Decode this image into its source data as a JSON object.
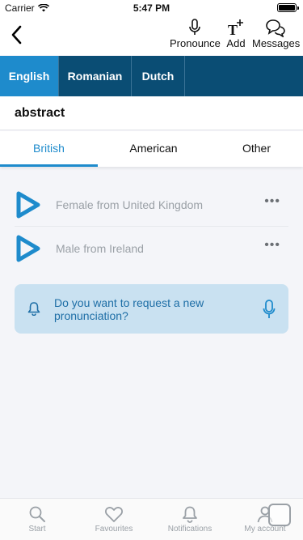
{
  "status_bar": {
    "carrier": "Carrier",
    "time": "5:47 PM"
  },
  "toolbar": {
    "pronounce_label": "Pronounce",
    "add_label": "Add",
    "messages_label": "Messages"
  },
  "languages": [
    {
      "label": "English",
      "active": true
    },
    {
      "label": "Romanian",
      "active": false
    },
    {
      "label": "Dutch",
      "active": false
    }
  ],
  "word": "abstract",
  "accents": [
    {
      "label": "British",
      "active": true
    },
    {
      "label": "American",
      "active": false
    },
    {
      "label": "Other",
      "active": false
    }
  ],
  "pronunciations": [
    {
      "label": "Female from United Kingdom",
      "more": "•••"
    },
    {
      "label": "Male from Ireland",
      "more": "•••"
    }
  ],
  "request": {
    "text": "Do you want to request a new pronunciation?"
  },
  "bottom_nav": [
    {
      "label": "Start",
      "icon": "search-icon"
    },
    {
      "label": "Favourites",
      "icon": "heart-icon"
    },
    {
      "label": "Notifications",
      "icon": "bell-icon"
    },
    {
      "label": "My account",
      "icon": "user-icon"
    }
  ],
  "colors": {
    "brand_dark": "#0a4d74",
    "accent": "#1e8bcc",
    "request_bg": "#c9e1f1"
  }
}
